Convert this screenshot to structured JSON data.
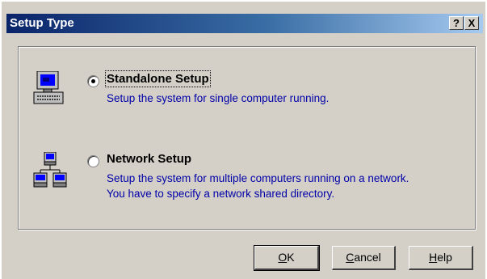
{
  "title": "Setup Type",
  "titlebar_buttons": {
    "help": "?",
    "close": "X"
  },
  "options": [
    {
      "label": "Standalone Setup",
      "selected": true,
      "description": [
        "Setup the system for single computer running."
      ],
      "icon": "computer-icon"
    },
    {
      "label": "Network Setup",
      "selected": false,
      "description": [
        "Setup the system for multiple computers running on a network.",
        "You have to specify a network shared directory."
      ],
      "icon": "network-icon"
    }
  ],
  "buttons": {
    "ok": {
      "mnemonic": "O",
      "rest": "K"
    },
    "cancel": {
      "mnemonic": "C",
      "rest": "ancel"
    },
    "help": {
      "mnemonic": "H",
      "rest": "elp"
    }
  },
  "colors": {
    "title_bar_start": "#0a246a",
    "title_bar_end": "#a6caf0",
    "description_text": "#0000a8",
    "dialog_face": "#d4d0c8"
  }
}
